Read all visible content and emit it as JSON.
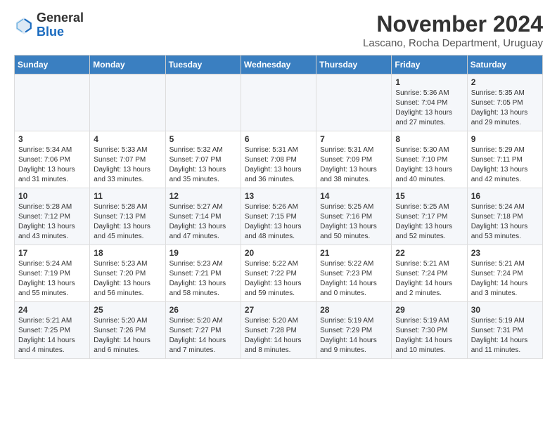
{
  "logo": {
    "general": "General",
    "blue": "Blue"
  },
  "header": {
    "month": "November 2024",
    "location": "Lascano, Rocha Department, Uruguay"
  },
  "weekdays": [
    "Sunday",
    "Monday",
    "Tuesday",
    "Wednesday",
    "Thursday",
    "Friday",
    "Saturday"
  ],
  "weeks": [
    [
      {
        "day": "",
        "info": ""
      },
      {
        "day": "",
        "info": ""
      },
      {
        "day": "",
        "info": ""
      },
      {
        "day": "",
        "info": ""
      },
      {
        "day": "",
        "info": ""
      },
      {
        "day": "1",
        "info": "Sunrise: 5:36 AM\nSunset: 7:04 PM\nDaylight: 13 hours\nand 27 minutes."
      },
      {
        "day": "2",
        "info": "Sunrise: 5:35 AM\nSunset: 7:05 PM\nDaylight: 13 hours\nand 29 minutes."
      }
    ],
    [
      {
        "day": "3",
        "info": "Sunrise: 5:34 AM\nSunset: 7:06 PM\nDaylight: 13 hours\nand 31 minutes."
      },
      {
        "day": "4",
        "info": "Sunrise: 5:33 AM\nSunset: 7:07 PM\nDaylight: 13 hours\nand 33 minutes."
      },
      {
        "day": "5",
        "info": "Sunrise: 5:32 AM\nSunset: 7:07 PM\nDaylight: 13 hours\nand 35 minutes."
      },
      {
        "day": "6",
        "info": "Sunrise: 5:31 AM\nSunset: 7:08 PM\nDaylight: 13 hours\nand 36 minutes."
      },
      {
        "day": "7",
        "info": "Sunrise: 5:31 AM\nSunset: 7:09 PM\nDaylight: 13 hours\nand 38 minutes."
      },
      {
        "day": "8",
        "info": "Sunrise: 5:30 AM\nSunset: 7:10 PM\nDaylight: 13 hours\nand 40 minutes."
      },
      {
        "day": "9",
        "info": "Sunrise: 5:29 AM\nSunset: 7:11 PM\nDaylight: 13 hours\nand 42 minutes."
      }
    ],
    [
      {
        "day": "10",
        "info": "Sunrise: 5:28 AM\nSunset: 7:12 PM\nDaylight: 13 hours\nand 43 minutes."
      },
      {
        "day": "11",
        "info": "Sunrise: 5:28 AM\nSunset: 7:13 PM\nDaylight: 13 hours\nand 45 minutes."
      },
      {
        "day": "12",
        "info": "Sunrise: 5:27 AM\nSunset: 7:14 PM\nDaylight: 13 hours\nand 47 minutes."
      },
      {
        "day": "13",
        "info": "Sunrise: 5:26 AM\nSunset: 7:15 PM\nDaylight: 13 hours\nand 48 minutes."
      },
      {
        "day": "14",
        "info": "Sunrise: 5:25 AM\nSunset: 7:16 PM\nDaylight: 13 hours\nand 50 minutes."
      },
      {
        "day": "15",
        "info": "Sunrise: 5:25 AM\nSunset: 7:17 PM\nDaylight: 13 hours\nand 52 minutes."
      },
      {
        "day": "16",
        "info": "Sunrise: 5:24 AM\nSunset: 7:18 PM\nDaylight: 13 hours\nand 53 minutes."
      }
    ],
    [
      {
        "day": "17",
        "info": "Sunrise: 5:24 AM\nSunset: 7:19 PM\nDaylight: 13 hours\nand 55 minutes."
      },
      {
        "day": "18",
        "info": "Sunrise: 5:23 AM\nSunset: 7:20 PM\nDaylight: 13 hours\nand 56 minutes."
      },
      {
        "day": "19",
        "info": "Sunrise: 5:23 AM\nSunset: 7:21 PM\nDaylight: 13 hours\nand 58 minutes."
      },
      {
        "day": "20",
        "info": "Sunrise: 5:22 AM\nSunset: 7:22 PM\nDaylight: 13 hours\nand 59 minutes."
      },
      {
        "day": "21",
        "info": "Sunrise: 5:22 AM\nSunset: 7:23 PM\nDaylight: 14 hours\nand 0 minutes."
      },
      {
        "day": "22",
        "info": "Sunrise: 5:21 AM\nSunset: 7:24 PM\nDaylight: 14 hours\nand 2 minutes."
      },
      {
        "day": "23",
        "info": "Sunrise: 5:21 AM\nSunset: 7:24 PM\nDaylight: 14 hours\nand 3 minutes."
      }
    ],
    [
      {
        "day": "24",
        "info": "Sunrise: 5:21 AM\nSunset: 7:25 PM\nDaylight: 14 hours\nand 4 minutes."
      },
      {
        "day": "25",
        "info": "Sunrise: 5:20 AM\nSunset: 7:26 PM\nDaylight: 14 hours\nand 6 minutes."
      },
      {
        "day": "26",
        "info": "Sunrise: 5:20 AM\nSunset: 7:27 PM\nDaylight: 14 hours\nand 7 minutes."
      },
      {
        "day": "27",
        "info": "Sunrise: 5:20 AM\nSunset: 7:28 PM\nDaylight: 14 hours\nand 8 minutes."
      },
      {
        "day": "28",
        "info": "Sunrise: 5:19 AM\nSunset: 7:29 PM\nDaylight: 14 hours\nand 9 minutes."
      },
      {
        "day": "29",
        "info": "Sunrise: 5:19 AM\nSunset: 7:30 PM\nDaylight: 14 hours\nand 10 minutes."
      },
      {
        "day": "30",
        "info": "Sunrise: 5:19 AM\nSunset: 7:31 PM\nDaylight: 14 hours\nand 11 minutes."
      }
    ]
  ]
}
